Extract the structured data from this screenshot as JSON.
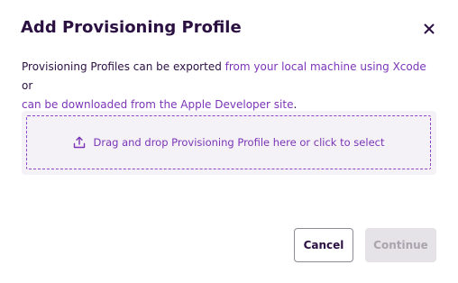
{
  "dialog": {
    "title": "Add Provisioning Profile",
    "close_icon": "close-icon"
  },
  "description": {
    "text_before": "Provisioning Profiles can be exported ",
    "link_xcode": "from your local machine using Xcode",
    "text_middle": " or ",
    "link_apple": "can be downloaded from the Apple Developer site",
    "text_after": "."
  },
  "dropzone": {
    "icon": "upload-icon",
    "label": "Drag and drop Provisioning Profile here or click to select"
  },
  "footer": {
    "cancel_label": "Cancel",
    "continue_label": "Continue",
    "continue_disabled": true
  },
  "colors": {
    "title": "#2b1042",
    "link": "#7b34b8",
    "dropzone_border": "#8b45c6",
    "dropzone_bg": "#f4f2f6",
    "disabled_button_bg": "#e5e3e8"
  }
}
